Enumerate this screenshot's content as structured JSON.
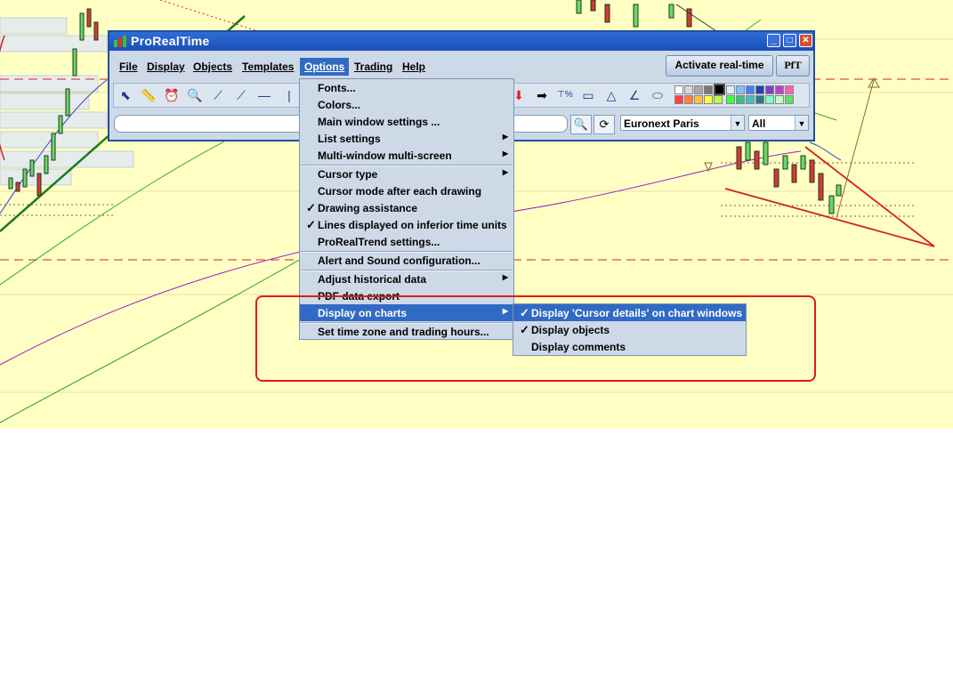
{
  "window": {
    "title": "ProRealTime"
  },
  "menubar": {
    "items": [
      "File",
      "Display",
      "Objects",
      "Templates",
      "Options",
      "Trading",
      "Help"
    ],
    "activate_label": "Activate real-time",
    "pft_label": "PfT"
  },
  "search": {
    "market": "Euronext Paris",
    "filter": "All"
  },
  "options_menu": {
    "items": [
      "Fonts...",
      "Colors...",
      "Main window settings ...",
      "List settings",
      "Multi-window multi-screen",
      "Cursor type",
      "Cursor mode after each drawing",
      "Drawing assistance",
      "Lines displayed on inferior time units",
      "ProRealTrend settings...",
      "Alert and Sound configuration...",
      "Adjust historical data",
      "PDF data export",
      "Display on charts",
      "Set time zone and trading hours..."
    ]
  },
  "display_submenu": {
    "items": [
      "Display 'Cursor details' on chart windows",
      "Display objects",
      "Display comments"
    ]
  },
  "check_mark": "✓",
  "colors": {
    "accent": "#316ac5",
    "chart_bg": "#ffffc4",
    "highlight": "#e01b1b"
  }
}
